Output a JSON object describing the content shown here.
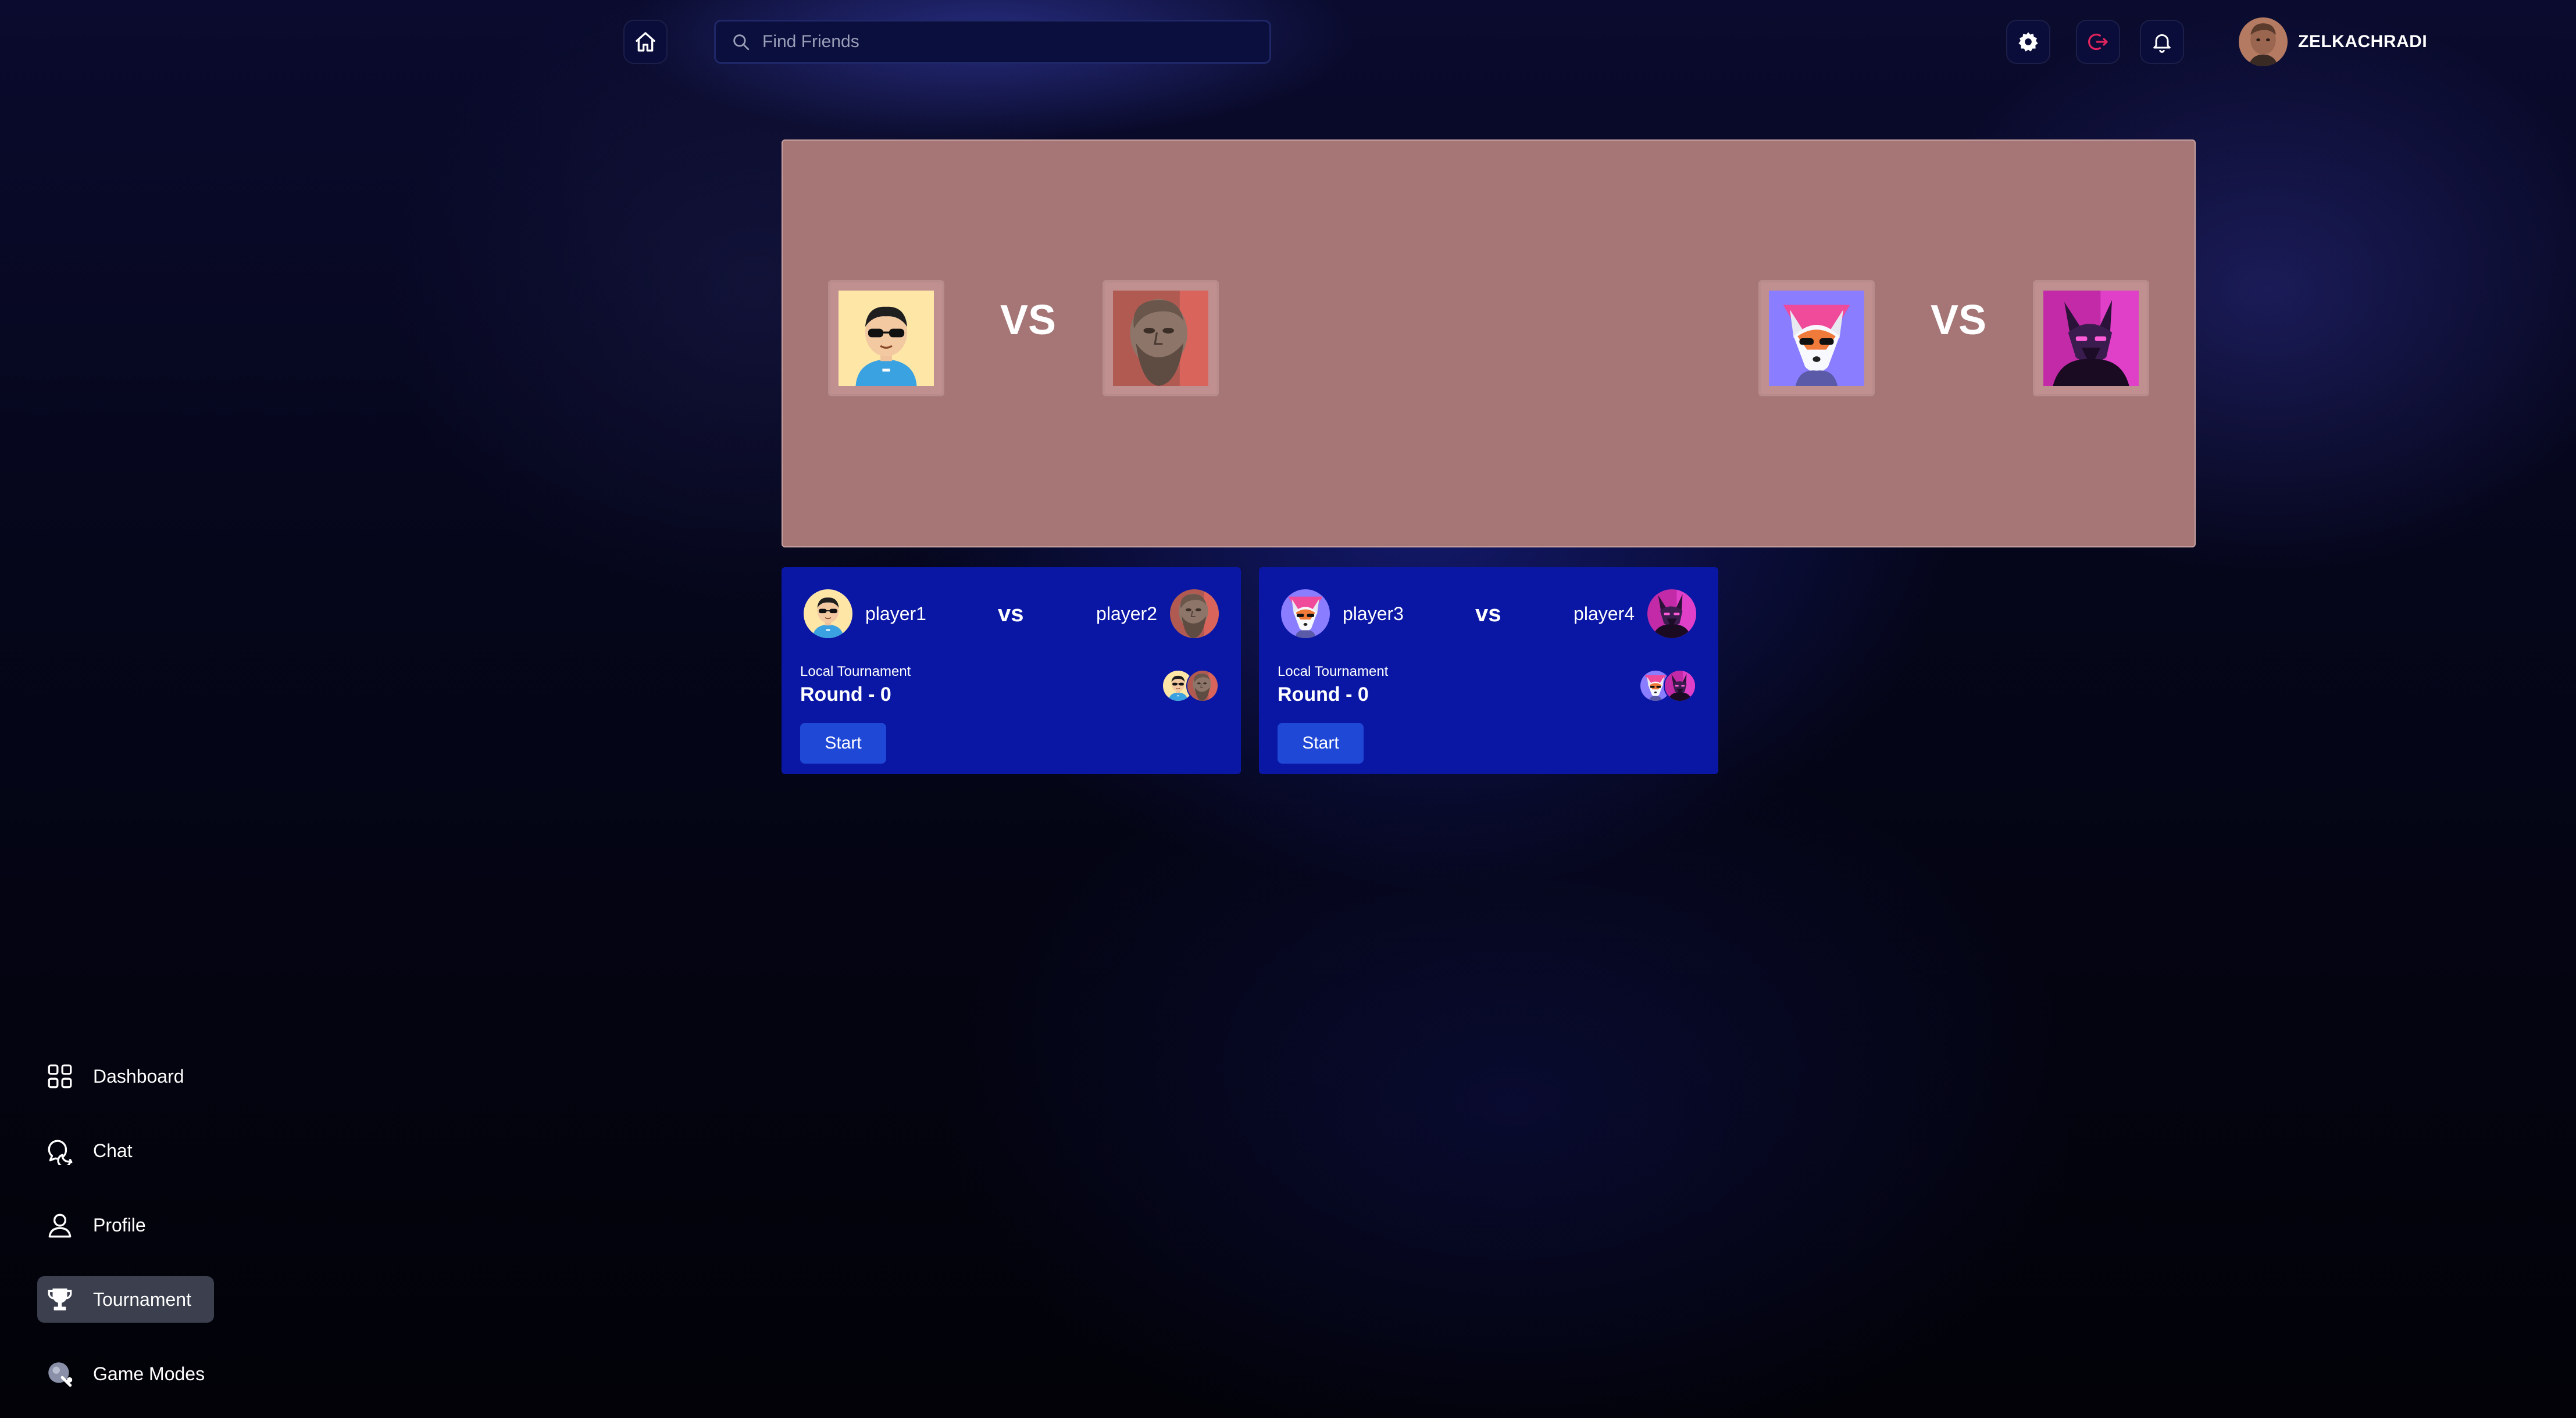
{
  "header": {
    "search_placeholder": "Find Friends",
    "username": "ZELKACHRADI"
  },
  "banner": {
    "matches": [
      {
        "vs": "VS"
      },
      {
        "vs": "VS"
      }
    ]
  },
  "matches": [
    {
      "player_left": "player1",
      "player_right": "player2",
      "vs": "vs",
      "type": "Local Tournament",
      "round": "Round - 0",
      "button": "Start"
    },
    {
      "player_left": "player3",
      "player_right": "player4",
      "vs": "vs",
      "type": "Local Tournament",
      "round": "Round - 0",
      "button": "Start"
    }
  ],
  "sidebar": {
    "items": [
      {
        "label": "Dashboard",
        "icon": "dashboard-icon"
      },
      {
        "label": "Chat",
        "icon": "chat-icon"
      },
      {
        "label": "Profile",
        "icon": "profile-icon"
      },
      {
        "label": "Tournament",
        "icon": "trophy-icon",
        "active": true
      },
      {
        "label": "Game Modes",
        "icon": "game-modes-icon"
      }
    ]
  },
  "colors": {
    "banner": "#a67676",
    "card": "#0a17a4",
    "start_button": "#1f48d6",
    "logout_icon": "#e0245e"
  }
}
